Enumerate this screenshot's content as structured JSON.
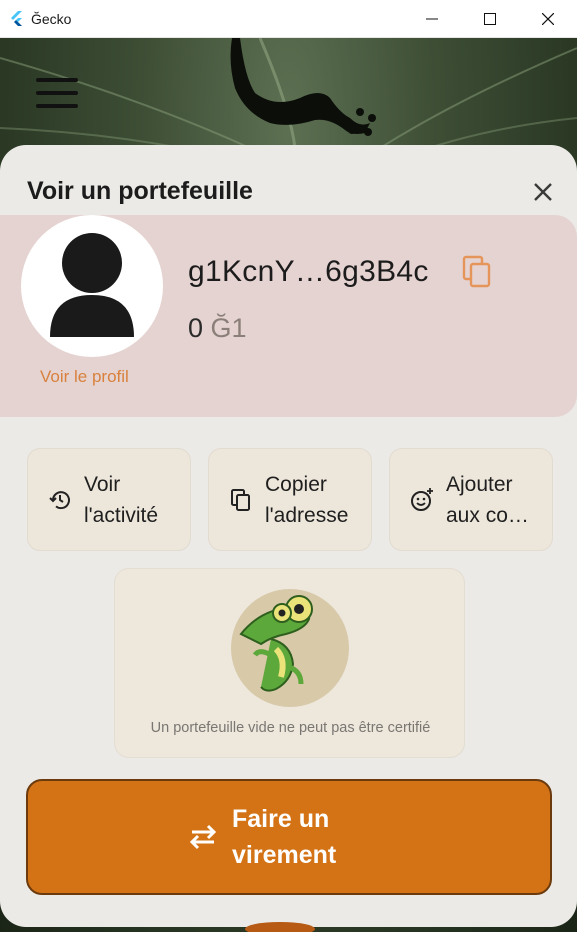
{
  "window": {
    "title": "Ğecko"
  },
  "sheet": {
    "title": "Voir un portefeuille"
  },
  "wallet": {
    "address": "g1KcnY…6g3B4c",
    "balance_value": "0",
    "balance_unit": "Ğ1",
    "profile_link": "Voir le profil"
  },
  "actions": [
    {
      "label": "Voir\nl'activité",
      "icon": "history-icon"
    },
    {
      "label": "Copier\nl'adresse",
      "icon": "copy-icon"
    },
    {
      "label": "Ajouter\naux co…",
      "icon": "add-reaction-icon"
    }
  ],
  "certification": {
    "message": "Un portefeuille vide ne peut pas être certifié"
  },
  "transfer": {
    "label": "Faire un virement",
    "icon": "swap-arrows-icon"
  },
  "colors": {
    "accent": "#d37316",
    "link": "#d8813d",
    "card_pink": "#e5d3d1"
  }
}
